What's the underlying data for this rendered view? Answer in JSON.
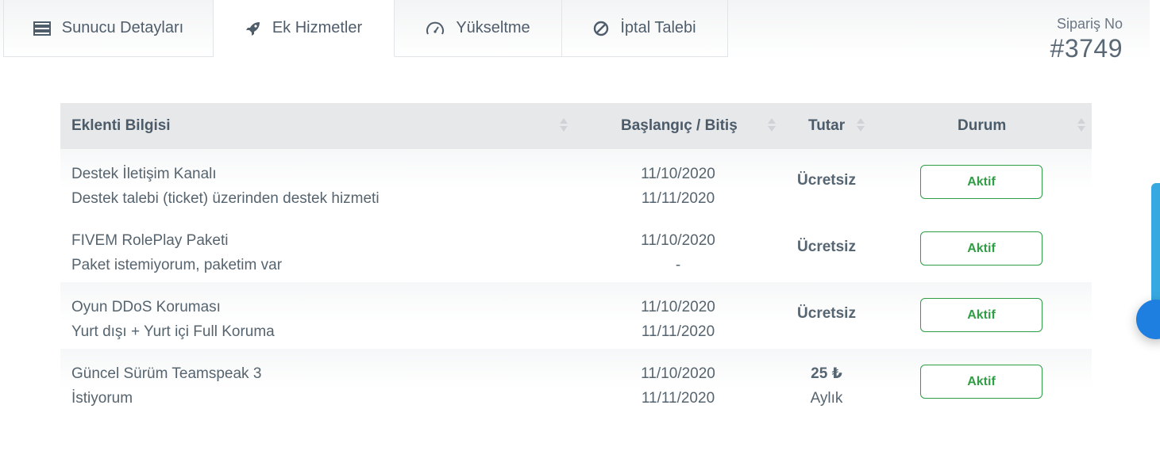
{
  "tabs": [
    {
      "label": "Sunucu Detayları",
      "icon": "server-icon"
    },
    {
      "label": "Ek Hizmetler",
      "icon": "rocket-icon"
    },
    {
      "label": "Yükseltme",
      "icon": "speedometer-icon"
    },
    {
      "label": "İptal Talebi",
      "icon": "ban-icon"
    }
  ],
  "order": {
    "label": "Sipariş No",
    "number": "#3749"
  },
  "table": {
    "headers": [
      "Eklenti Bilgisi",
      "Başlangıç / Bitiş",
      "Tutar",
      "Durum"
    ],
    "rows": [
      {
        "name": "Destek İletişim Kanalı",
        "desc": "Destek talebi (ticket) üzerinden destek hizmeti",
        "start": "11/10/2020",
        "end": "11/11/2020",
        "price": "Ücretsiz",
        "period": "",
        "status": "Aktif"
      },
      {
        "name": "FIVEM RolePlay Paketi",
        "desc": "Paket istemiyorum, paketim var",
        "start": "11/10/2020",
        "end": "-",
        "price": "Ücretsiz",
        "period": "",
        "status": "Aktif"
      },
      {
        "name": "Oyun DDoS Koruması",
        "desc": "Yurt dışı + Yurt içi Full Koruma",
        "start": "11/10/2020",
        "end": "11/11/2020",
        "price": "Ücretsiz",
        "period": "",
        "status": "Aktif"
      },
      {
        "name": "Güncel Sürüm Teamspeak 3",
        "desc": "İstiyorum",
        "start": "11/10/2020",
        "end": "11/11/2020",
        "price": "25 ₺",
        "period": "Aylık",
        "status": "Aktif"
      }
    ]
  },
  "colors": {
    "active_status": "#2f9e44",
    "header_bg": "#e7e8e9",
    "side_strip": "#37a9e0",
    "chat": "#1f7fe0"
  }
}
